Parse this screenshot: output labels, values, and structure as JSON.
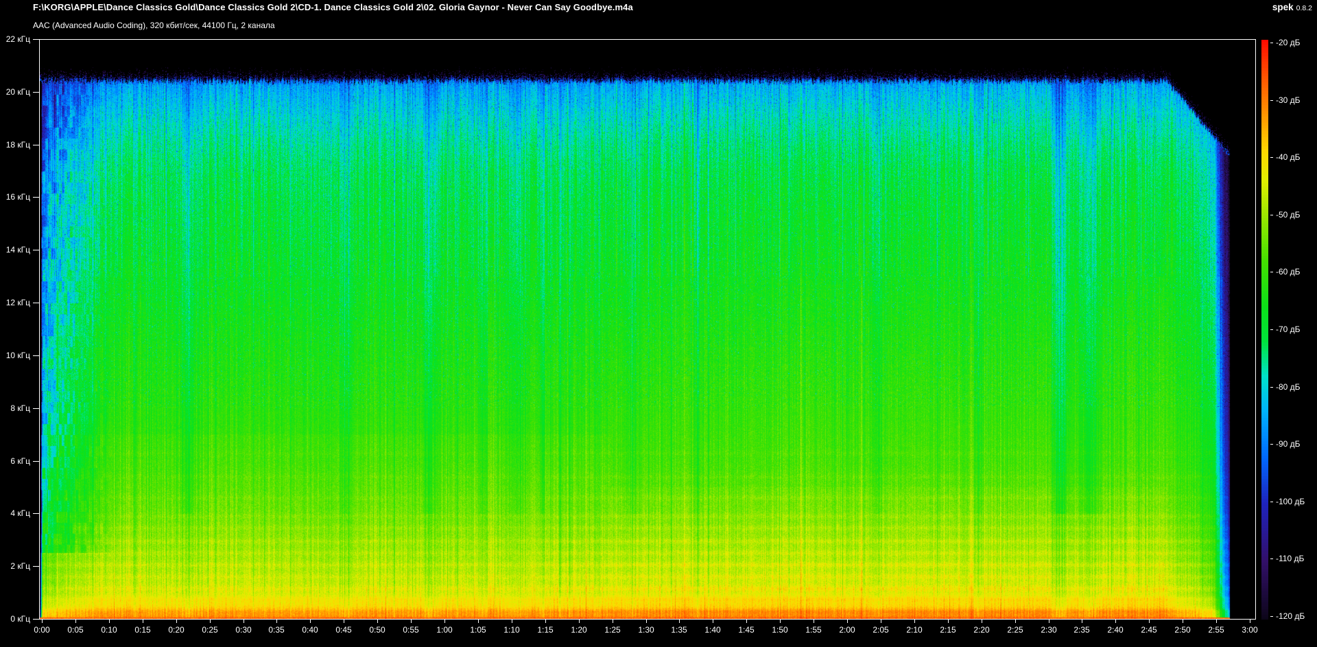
{
  "app": {
    "name": "spek",
    "version": "0.8.2"
  },
  "header": {
    "file_path": "F:\\KORG\\APPLE\\Dance Classics Gold\\Dance Classics Gold 2\\CD-1. Dance Classics Gold 2\\02. Gloria Gaynor - Never Can Say Goodbye.m4a",
    "codec_info": "AAC (Advanced Audio Coding), 320 кбит/сек, 44100 Гц, 2 канала"
  },
  "chart_data": {
    "type": "heatmap",
    "subtype": "audio-spectrogram",
    "title": "02. Gloria Gaynor - Never Can Say Goodbye.m4a",
    "x_axis": {
      "unit": "time (m:ss)",
      "min_s": 0,
      "max_s": 180,
      "tick_interval_s": 5,
      "tick_labels": [
        "0:00",
        "0:05",
        "0:10",
        "0:15",
        "0:20",
        "0:25",
        "0:30",
        "0:35",
        "0:40",
        "0:45",
        "0:50",
        "0:55",
        "1:00",
        "1:05",
        "1:10",
        "1:15",
        "1:20",
        "1:25",
        "1:30",
        "1:35",
        "1:40",
        "1:45",
        "1:50",
        "1:55",
        "2:00",
        "2:05",
        "2:10",
        "2:15",
        "2:20",
        "2:25",
        "2:30",
        "2:35",
        "2:40",
        "2:45",
        "2:50",
        "2:55",
        "3:00"
      ]
    },
    "y_axis": {
      "unit": "кГц",
      "min_khz": 0,
      "max_khz": 22,
      "tick_interval_khz": 2,
      "tick_labels": [
        "22 кГц",
        "20 кГц",
        "18 кГц",
        "16 кГц",
        "14 кГц",
        "12 кГц",
        "10 кГц",
        "8 кГц",
        "6 кГц",
        "4 кГц",
        "2 кГц",
        "0 кГц"
      ]
    },
    "colorbar": {
      "unit": "дБ",
      "max_db": -20,
      "min_db": -120,
      "tick_interval_db": 10,
      "tick_labels": [
        "-20 дБ",
        "-30 дБ",
        "-40 дБ",
        "-50 дБ",
        "-60 дБ",
        "-70 дБ",
        "-80 дБ",
        "-90 дБ",
        "-100 дБ",
        "-110 дБ",
        "-120 дБ"
      ],
      "gradient_stops": [
        [
          -125,
          0,
          0,
          0
        ],
        [
          -120,
          12,
          6,
          25
        ],
        [
          -110,
          50,
          15,
          105
        ],
        [
          -100,
          30,
          35,
          190
        ],
        [
          -92,
          0,
          105,
          255
        ],
        [
          -84,
          0,
          180,
          252
        ],
        [
          -78,
          0,
          225,
          200
        ],
        [
          -72,
          0,
          228,
          60
        ],
        [
          -66,
          12,
          225,
          25
        ],
        [
          -58,
          70,
          225,
          0
        ],
        [
          -50,
          160,
          232,
          0
        ],
        [
          -44,
          228,
          238,
          0
        ],
        [
          -39,
          255,
          215,
          0
        ],
        [
          -32,
          255,
          140,
          0
        ],
        [
          -26,
          255,
          80,
          0
        ],
        [
          -20,
          255,
          10,
          0
        ]
      ]
    },
    "content": {
      "sample_rate_hz": 44100,
      "channels": 2,
      "bitrate": "320 кбит/сек",
      "lowpass_cutoff_khz": 20.4,
      "audio_end_s": 177.3,
      "fade_out_start_s": 168,
      "fade_out_steep_s": 174.8,
      "intro_sparse_until_s": 12,
      "freq_profile_db": [
        [
          0,
          -29
        ],
        [
          0.1,
          -33
        ],
        [
          0.5,
          -41
        ],
        [
          1,
          -46
        ],
        [
          2,
          -49.5
        ],
        [
          3,
          -52
        ],
        [
          4,
          -55
        ],
        [
          6,
          -59
        ],
        [
          8,
          -61
        ],
        [
          10,
          -63
        ],
        [
          12,
          -65.5
        ],
        [
          14,
          -67.5
        ],
        [
          16,
          -69.5
        ],
        [
          17,
          -71
        ],
        [
          18,
          -74
        ],
        [
          19,
          -78
        ],
        [
          20,
          -83
        ],
        [
          20.4,
          -86
        ],
        [
          22,
          -88
        ]
      ],
      "harmonic_bands_khz_db": [
        [
          0.28,
          2.5
        ],
        [
          0.75,
          2.0
        ],
        [
          1.15,
          2.6
        ],
        [
          1.6,
          2.2
        ],
        [
          2.05,
          3.0
        ],
        [
          2.5,
          2.2
        ],
        [
          2.95,
          2.6
        ],
        [
          3.45,
          2.0
        ],
        [
          3.9,
          1.8
        ],
        [
          4.6,
          1.4
        ],
        [
          5.4,
          1.2
        ],
        [
          6.3,
          1.0
        ]
      ],
      "quiet_dips": [
        {
          "t": 22,
          "w": 1.0,
          "d": 6.5
        },
        {
          "t": 45.5,
          "w": 0.7,
          "d": 4
        },
        {
          "t": 58,
          "w": 1.0,
          "d": 5.5
        },
        {
          "t": 66,
          "w": 0.6,
          "d": 4
        },
        {
          "t": 71.3,
          "w": 1.3,
          "d": 4.5
        },
        {
          "t": 74.9,
          "w": 0.35,
          "d": 7
        },
        {
          "t": 88.5,
          "w": 0.9,
          "d": 5
        },
        {
          "t": 98,
          "w": 0.6,
          "d": 3.5
        },
        {
          "t": 125,
          "w": 0.7,
          "d": 4
        },
        {
          "t": 140,
          "w": 0.5,
          "d": 3
        },
        {
          "t": 152.2,
          "w": 1.1,
          "d": 10
        },
        {
          "t": 156.6,
          "w": 1.5,
          "d": 8.5
        }
      ]
    }
  }
}
